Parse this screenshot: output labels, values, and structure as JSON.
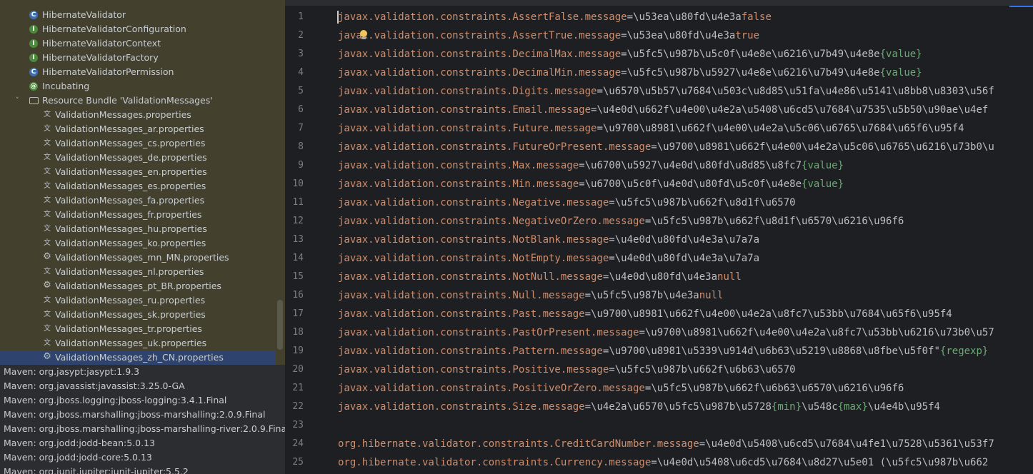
{
  "tree": {
    "items": [
      {
        "label": "HibernateValidator",
        "icon": "class-icon"
      },
      {
        "label": "HibernateValidatorConfiguration",
        "icon": "interface-icon"
      },
      {
        "label": "HibernateValidatorContext",
        "icon": "interface-icon"
      },
      {
        "label": "HibernateValidatorFactory",
        "icon": "interface-icon"
      },
      {
        "label": "HibernateValidatorPermission",
        "icon": "class-icon"
      },
      {
        "label": "Incubating",
        "icon": "annotation-icon"
      },
      {
        "label": "Resource Bundle 'ValidationMessages'",
        "icon": "folder-icon"
      },
      {
        "label": "ValidationMessages.properties",
        "icon": "properties-icon"
      },
      {
        "label": "ValidationMessages_ar.properties",
        "icon": "properties-icon"
      },
      {
        "label": "ValidationMessages_cs.properties",
        "icon": "properties-icon"
      },
      {
        "label": "ValidationMessages_de.properties",
        "icon": "properties-icon"
      },
      {
        "label": "ValidationMessages_en.properties",
        "icon": "properties-icon"
      },
      {
        "label": "ValidationMessages_es.properties",
        "icon": "properties-icon"
      },
      {
        "label": "ValidationMessages_fa.properties",
        "icon": "properties-icon"
      },
      {
        "label": "ValidationMessages_fr.properties",
        "icon": "properties-icon"
      },
      {
        "label": "ValidationMessages_hu.properties",
        "icon": "properties-icon"
      },
      {
        "label": "ValidationMessages_ko.properties",
        "icon": "properties-icon"
      },
      {
        "label": "ValidationMessages_mn_MN.properties",
        "icon": "gear-icon"
      },
      {
        "label": "ValidationMessages_nl.properties",
        "icon": "properties-icon"
      },
      {
        "label": "ValidationMessages_pt_BR.properties",
        "icon": "gear-icon"
      },
      {
        "label": "ValidationMessages_ru.properties",
        "icon": "properties-icon"
      },
      {
        "label": "ValidationMessages_sk.properties",
        "icon": "properties-icon"
      },
      {
        "label": "ValidationMessages_tr.properties",
        "icon": "properties-icon"
      },
      {
        "label": "ValidationMessages_uk.properties",
        "icon": "properties-icon"
      },
      {
        "label": "ValidationMessages_zh_CN.properties",
        "icon": "gear-icon",
        "selected": true
      }
    ],
    "libraries": [
      "Maven: org.jasypt:jasypt:1.9.3",
      "Maven: org.javassist:javassist:3.25.0-GA",
      "Maven: org.jboss.logging:jboss-logging:3.4.1.Final",
      "Maven: org.jboss.marshalling:jboss-marshalling:2.0.9.Final",
      "Maven: org.jboss.marshalling:jboss-marshalling-river:2.0.9.Final",
      "Maven: org.jodd:jodd-bean:5.0.13",
      "Maven: org.jodd:jodd-core:5.0.13",
      "Maven: org.junit.jupiter:junit-jupiter:5.5.2"
    ]
  },
  "editor": {
    "lines": [
      {
        "n": "1",
        "k": "javax.validation.constraints.AssertFalse.message",
        "v": "\\u53ea\\u80fd\\u4e3a",
        "kw": "false"
      },
      {
        "n": "2",
        "k": "javax.validation.constraints.AssertTrue.message",
        "v": "\\u53ea\\u80fd\\u4e3a",
        "kw": "true"
      },
      {
        "n": "3",
        "k": "javax.validation.constraints.DecimalMax.message",
        "v": "\\u5fc5\\u987b\\u5c0f\\u4e8e\\u6216\\u7b49\\u4e8e",
        "ph": "{value}"
      },
      {
        "n": "4",
        "k": "javax.validation.constraints.DecimalMin.message",
        "v": "\\u5fc5\\u987b\\u5927\\u4e8e\\u6216\\u7b49\\u4e8e",
        "ph": "{value}"
      },
      {
        "n": "5",
        "k": "javax.validation.constraints.Digits.message",
        "v": "\\u6570\\u5b57\\u7684\\u503c\\u8d85\\u51fa\\u4e86\\u5141\\u8bb8\\u8303\\u56f"
      },
      {
        "n": "6",
        "k": "javax.validation.constraints.Email.message",
        "v": "\\u4e0d\\u662f\\u4e00\\u4e2a\\u5408\\u6cd5\\u7684\\u7535\\u5b50\\u90ae\\u4ef"
      },
      {
        "n": "7",
        "k": "javax.validation.constraints.Future.message",
        "v": "\\u9700\\u8981\\u662f\\u4e00\\u4e2a\\u5c06\\u6765\\u7684\\u65f6\\u95f4"
      },
      {
        "n": "8",
        "k": "javax.validation.constraints.FutureOrPresent.message",
        "v": "\\u9700\\u8981\\u662f\\u4e00\\u4e2a\\u5c06\\u6765\\u6216\\u73b0\\u"
      },
      {
        "n": "9",
        "k": "javax.validation.constraints.Max.message",
        "v": "\\u6700\\u5927\\u4e0d\\u80fd\\u8d85\\u8fc7",
        "ph": "{value}"
      },
      {
        "n": "10",
        "k": "javax.validation.constraints.Min.message",
        "v": "\\u6700\\u5c0f\\u4e0d\\u80fd\\u5c0f\\u4e8e",
        "ph": "{value}"
      },
      {
        "n": "11",
        "k": "javax.validation.constraints.Negative.message",
        "v": "\\u5fc5\\u987b\\u662f\\u8d1f\\u6570"
      },
      {
        "n": "12",
        "k": "javax.validation.constraints.NegativeOrZero.message",
        "v": "\\u5fc5\\u987b\\u662f\\u8d1f\\u6570\\u6216\\u96f6"
      },
      {
        "n": "13",
        "k": "javax.validation.constraints.NotBlank.message",
        "v": "\\u4e0d\\u80fd\\u4e3a\\u7a7a"
      },
      {
        "n": "14",
        "k": "javax.validation.constraints.NotEmpty.message",
        "v": "\\u4e0d\\u80fd\\u4e3a\\u7a7a"
      },
      {
        "n": "15",
        "k": "javax.validation.constraints.NotNull.message",
        "v": "\\u4e0d\\u80fd\\u4e3a",
        "kw": "null"
      },
      {
        "n": "16",
        "k": "javax.validation.constraints.Null.message",
        "v": "\\u5fc5\\u987b\\u4e3a",
        "kw": "null"
      },
      {
        "n": "17",
        "k": "javax.validation.constraints.Past.message",
        "v": "\\u9700\\u8981\\u662f\\u4e00\\u4e2a\\u8fc7\\u53bb\\u7684\\u65f6\\u95f4"
      },
      {
        "n": "18",
        "k": "javax.validation.constraints.PastOrPresent.message",
        "v": "\\u9700\\u8981\\u662f\\u4e00\\u4e2a\\u8fc7\\u53bb\\u6216\\u73b0\\u57"
      },
      {
        "n": "19",
        "k": "javax.validation.constraints.Pattern.message",
        "v": "\\u9700\\u8981\\u5339\\u914d\\u6b63\\u5219\\u8868\\u8fbe\\u5f0f\"",
        "ph": "{regexp}"
      },
      {
        "n": "20",
        "k": "javax.validation.constraints.Positive.message",
        "v": "\\u5fc5\\u987b\\u662f\\u6b63\\u6570"
      },
      {
        "n": "21",
        "k": "javax.validation.constraints.PositiveOrZero.message",
        "v": "\\u5fc5\\u987b\\u662f\\u6b63\\u6570\\u6216\\u96f6"
      },
      {
        "n": "22",
        "k": "javax.validation.constraints.Size.message",
        "v": "\\u4e2a\\u6570\\u5fc5\\u987b\\u5728",
        "ph": "{min}",
        "v2": "\\u548c",
        "ph2": "{max}",
        "v3": "\\u4e4b\\u95f4"
      },
      {
        "n": "23",
        "k": "",
        "v": ""
      },
      {
        "n": "24",
        "k": "org.hibernate.validator.constraints.CreditCardNumber.message",
        "v": "\\u4e0d\\u5408\\u6cd5\\u7684\\u4fe1\\u7528\\u5361\\u53f7"
      },
      {
        "n": "25",
        "k": "org.hibernate.validator.constraints.Currency.message",
        "v": "\\u4e0d\\u5408\\u6cd5\\u7684\\u8d27\\u5e01 (\\u5fc5\\u987b\\u662"
      }
    ]
  }
}
